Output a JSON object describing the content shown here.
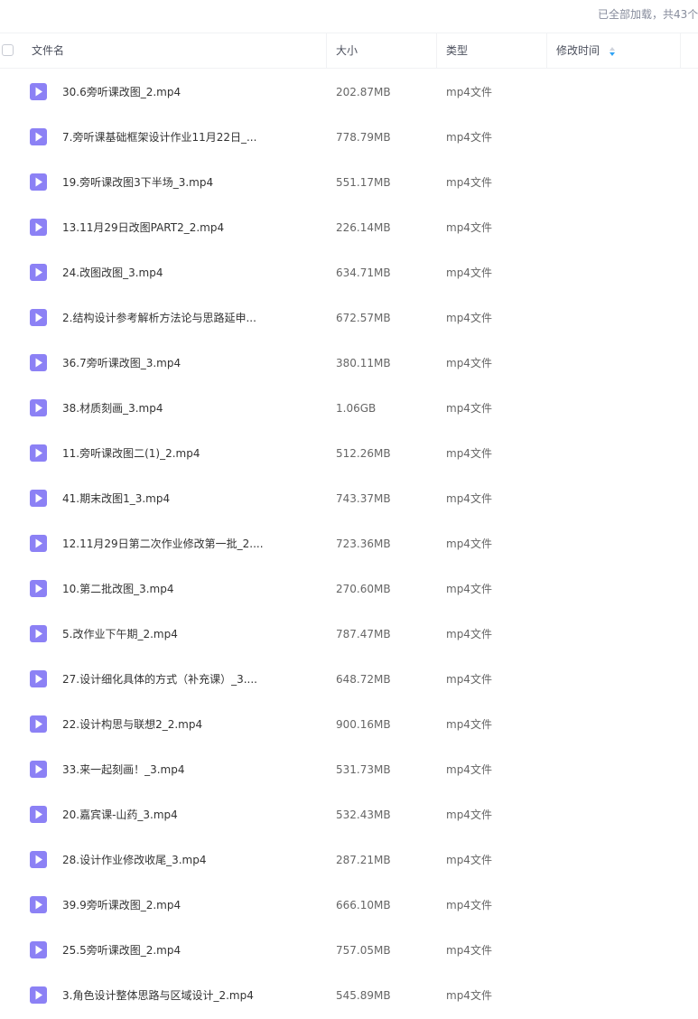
{
  "status": {
    "loaded_text": "已全部加载，共43个"
  },
  "header": {
    "name_label": "文件名",
    "size_label": "大小",
    "type_label": "类型",
    "time_label": "修改时间"
  },
  "colors": {
    "video_icon": "#8c81f5",
    "sort_up": "#cfd3dc",
    "sort_down": "#2fa3f5"
  },
  "files": [
    {
      "name": "30.6旁听课改图_2.mp4",
      "size": "202.87MB",
      "type": "mp4文件"
    },
    {
      "name": "7.旁听课基础框架设计作业11月22日_...",
      "size": "778.79MB",
      "type": "mp4文件"
    },
    {
      "name": "19.旁听课改图3下半场_3.mp4",
      "size": "551.17MB",
      "type": "mp4文件"
    },
    {
      "name": "13.11月29日改图PART2_2.mp4",
      "size": "226.14MB",
      "type": "mp4文件"
    },
    {
      "name": "24.改图改图_3.mp4",
      "size": "634.71MB",
      "type": "mp4文件"
    },
    {
      "name": "2.结构设计参考解析方法论与思路延申...",
      "size": "672.57MB",
      "type": "mp4文件"
    },
    {
      "name": "36.7旁听课改图_3.mp4",
      "size": "380.11MB",
      "type": "mp4文件"
    },
    {
      "name": "38.材质刻画_3.mp4",
      "size": "1.06GB",
      "type": "mp4文件"
    },
    {
      "name": "11.旁听课改图二(1)_2.mp4",
      "size": "512.26MB",
      "type": "mp4文件"
    },
    {
      "name": "41.期末改图1_3.mp4",
      "size": "743.37MB",
      "type": "mp4文件"
    },
    {
      "name": "12.11月29日第二次作业修改第一批_2....",
      "size": "723.36MB",
      "type": "mp4文件"
    },
    {
      "name": "10.第二批改图_3.mp4",
      "size": "270.60MB",
      "type": "mp4文件"
    },
    {
      "name": "5.改作业下午期_2.mp4",
      "size": "787.47MB",
      "type": "mp4文件"
    },
    {
      "name": "27.设计细化具体的方式（补充课）_3....",
      "size": "648.72MB",
      "type": "mp4文件"
    },
    {
      "name": "22.设计构思与联想2_2.mp4",
      "size": "900.16MB",
      "type": "mp4文件"
    },
    {
      "name": "33.来一起刻画！_3.mp4",
      "size": "531.73MB",
      "type": "mp4文件"
    },
    {
      "name": "20.嘉宾课-山药_3.mp4",
      "size": "532.43MB",
      "type": "mp4文件"
    },
    {
      "name": "28.设计作业修改收尾_3.mp4",
      "size": "287.21MB",
      "type": "mp4文件"
    },
    {
      "name": "39.9旁听课改图_2.mp4",
      "size": "666.10MB",
      "type": "mp4文件"
    },
    {
      "name": "25.5旁听课改图_2.mp4",
      "size": "757.05MB",
      "type": "mp4文件"
    },
    {
      "name": "3.角色设计整体思路与区域设计_2.mp4",
      "size": "545.89MB",
      "type": "mp4文件"
    }
  ]
}
